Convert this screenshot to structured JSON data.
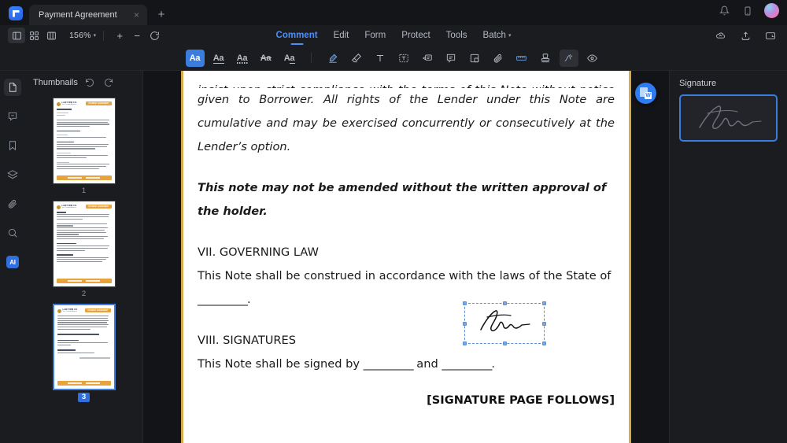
{
  "window": {
    "tab_title": "Payment Agreement",
    "close_label": "×",
    "new_tab_label": "+",
    "controls": [
      "notifications-bell",
      "mobile-device",
      "user-avatar"
    ]
  },
  "toolbar_top": {
    "view_buttons": [
      "sidebar-toggle",
      "grid-view",
      "split-view"
    ],
    "zoom_value": "156%",
    "zoom_caret": "▾",
    "zoom_out": "−",
    "zoom_in": "+",
    "rotate": "rotate-view",
    "right_icons": [
      "cloud-sync",
      "share-upload",
      "present-screen"
    ]
  },
  "menu": {
    "items": [
      {
        "label": "Comment",
        "active": true
      },
      {
        "label": "Edit",
        "active": false
      },
      {
        "label": "Form",
        "active": false
      },
      {
        "label": "Protect",
        "active": false
      },
      {
        "label": "Tools",
        "active": false
      },
      {
        "label": "Batch",
        "active": false,
        "caret": "▾"
      }
    ]
  },
  "comment_tools": [
    {
      "name": "highlight-text-tool",
      "label": "Aa",
      "state": "selected"
    },
    {
      "name": "underline-text-tool",
      "label": "Aa",
      "state": "normal"
    },
    {
      "name": "squiggly-underline-tool",
      "label": "Aa",
      "state": "normal"
    },
    {
      "name": "strikethrough-text-tool",
      "label": "Aa",
      "state": "normal"
    },
    {
      "name": "replace-text-tool",
      "label": "Aa",
      "state": "normal"
    },
    {
      "name": "highlighter-pen-tool",
      "label": "",
      "state": "normal"
    },
    {
      "name": "eraser-tool",
      "label": "",
      "state": "normal"
    },
    {
      "name": "add-text-tool",
      "label": "T",
      "state": "normal"
    },
    {
      "name": "text-box-tool",
      "label": "",
      "state": "normal"
    },
    {
      "name": "callout-tool",
      "label": "",
      "state": "normal"
    },
    {
      "name": "sticky-note-tool",
      "label": "",
      "state": "normal"
    },
    {
      "name": "shape-rectangle-tool",
      "label": "",
      "state": "normal"
    },
    {
      "name": "attach-file-tool",
      "label": "",
      "state": "normal"
    },
    {
      "name": "measure-tool",
      "label": "",
      "state": "normal"
    },
    {
      "name": "stamp-tool",
      "label": "",
      "state": "normal"
    },
    {
      "name": "signature-tool",
      "label": "",
      "state": "active"
    },
    {
      "name": "show-comments-tool",
      "label": "",
      "state": "normal"
    }
  ],
  "rail": [
    {
      "name": "thumbnails",
      "active": true
    },
    {
      "name": "comments",
      "active": false
    },
    {
      "name": "bookmarks",
      "active": false
    },
    {
      "name": "layers",
      "active": false
    },
    {
      "name": "attachments",
      "active": false
    },
    {
      "name": "search",
      "active": false
    },
    {
      "name": "ai-assistant",
      "active": false,
      "label": "AI"
    }
  ],
  "thumbnails": {
    "title": "Thumbnails",
    "rotate_left": "↺",
    "rotate_right": "↻",
    "pages": [
      {
        "number": "1",
        "selected": false,
        "company": "LAW FIRM CO.",
        "company_sub": "Your Trusted Advisors",
        "tag": "PAYMENT AGREEMENT"
      },
      {
        "number": "2",
        "selected": false,
        "company": "LAW FIRM CO.",
        "company_sub": "Your Trusted Advisors",
        "tag": "PAYMENT AGREEMENT"
      },
      {
        "number": "3",
        "selected": true,
        "company": "LAW FIRM CO.",
        "company_sub": "Your Trusted Advisors",
        "tag": "PAYMENT AGREEMENT"
      }
    ]
  },
  "document": {
    "para_clipped": "insist upon strict compliance with the terms of this Note without notice being",
    "para1": "given to Borrower. All rights of the Lender under this Note are cumulative and may be exercised concurrently or consecutively at the Lender’s option.",
    "para2": "This note may not be amended without the written approval of the holder.",
    "heading_vii": "VII. GOVERNING LAW",
    "para3_a": "This Note shall be construed in accordance with the laws of the State of",
    "para3_b": "__________.",
    "heading_viii": "VIII. SIGNATURES",
    "para4_a": "This Note shall be signed by",
    "para4_blank1": "__________",
    "para4_and": "and",
    "para4_blank2": "__________.",
    "footer_note": "[SIGNATURE PAGE FOLLOWS]"
  },
  "signature_annotation": {
    "name": "placed-signature",
    "selected": true,
    "handles": 8
  },
  "convert_button": {
    "name": "convert-to-word",
    "glyph": "W"
  },
  "signature_panel": {
    "title": "Signature",
    "items": [
      {
        "name": "saved-signature-1",
        "selected": true
      }
    ]
  },
  "colors": {
    "accent_blue": "#3b7ddd",
    "menu_active": "#4e8ff5",
    "page_border_gold": "#d6ab4a",
    "brand_orange": "#e8a33d",
    "app_bg": "#1b1c20",
    "viewer_bg": "#131418"
  }
}
